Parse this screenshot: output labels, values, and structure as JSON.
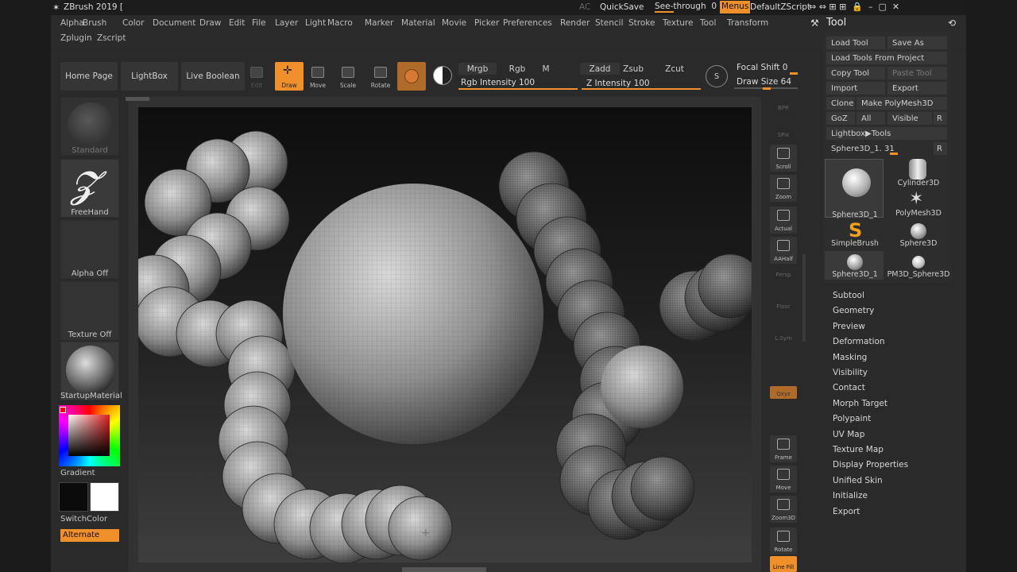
{
  "titlebar": {
    "app_title": "ZBrush 2019 [",
    "ac": "AC",
    "quicksave": "QuickSave",
    "seethrough": "See-through",
    "seethrough_value": "0",
    "menus": "Menus",
    "script": "DefaultZScript"
  },
  "menus": [
    "Alpha",
    "Brush",
    "Color",
    "Document",
    "Draw",
    "Edit",
    "File",
    "Layer",
    "Light",
    "Macro",
    "Marker",
    "Material",
    "Movie",
    "Picker",
    "Preferences",
    "Render",
    "Stencil",
    "Stroke",
    "Texture",
    "Tool",
    "Transform"
  ],
  "menus2": [
    "Zplugin",
    "Zscript"
  ],
  "toolbar": {
    "home": "Home Page",
    "lightbox": "LightBox",
    "liveboolean": "Live Boolean",
    "modes": [
      {
        "label": "Edit"
      },
      {
        "label": "Draw"
      },
      {
        "label": "Move"
      },
      {
        "label": "Scale"
      },
      {
        "label": "Rotate"
      }
    ],
    "mrgb": "Mrgb",
    "rgb": "Rgb",
    "m": "M",
    "zadd": "Zadd",
    "zsub": "Zsub",
    "zcut": "Zcut",
    "rgb_intensity": "Rgb Intensity 100",
    "z_intensity": "Z Intensity 100",
    "rgb_intensity_value": 100,
    "z_intensity_value": 100,
    "focal": "Focal Shift 0",
    "drawsize": "Draw Size 64",
    "focal_value": 0,
    "drawsize_value": 64
  },
  "left": {
    "standard": "Standard",
    "freehand": "FreeHand",
    "alpha": "Alpha Off",
    "texture": "Texture Off",
    "material": "StartupMaterial",
    "gradient": "Gradient",
    "switchcolor": "SwitchColor",
    "alternate": "Alternate"
  },
  "shelf": [
    "BPR",
    "SPix",
    "Scroll",
    "Zoom",
    "Actual",
    "AAHalf",
    "Persp",
    "Floor",
    "L.Sym",
    "",
    "Qxyz",
    "",
    "Frame",
    "Move",
    "Zoom3D",
    "Rotate",
    "Line Fill"
  ],
  "tool": {
    "title": "Tool",
    "buttons": {
      "load": "Load Tool",
      "saveas": "Save As",
      "loadproj": "Load Tools From Project",
      "copy": "Copy Tool",
      "paste": "Paste Tool",
      "import": "Import",
      "export": "Export",
      "clone": "Clone",
      "makepoly": "Make PolyMesh3D",
      "goz": "GoZ",
      "all": "All",
      "visible": "Visible",
      "r": "R",
      "lightboxtools": "Lightbox▶Tools",
      "slider": "Sphere3D_1. 31"
    },
    "tiles": [
      "Sphere3D_1",
      "Cylinder3D",
      "PolyMesh3D",
      "SimpleBrush",
      "Sphere3D",
      "Sphere3D_1",
      "PM3D_Sphere3D"
    ],
    "submenus": [
      "Subtool",
      "Geometry",
      "Preview",
      "Deformation",
      "Masking",
      "Visibility",
      "Contact",
      "Morph Target",
      "Polypaint",
      "UV Map",
      "Texture Map",
      "Display Properties",
      "Unified Skin",
      "Initialize",
      "Export"
    ]
  },
  "colors": {
    "accent": "#f0902a",
    "bg": "#2a2a2a"
  }
}
